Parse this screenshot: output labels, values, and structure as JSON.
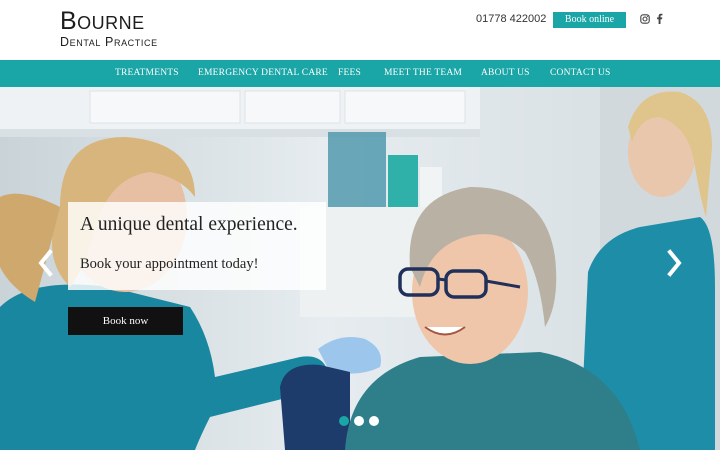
{
  "header": {
    "logo_main": "Bourne",
    "logo_sub": "Dental Practice",
    "phone": "01778 422002",
    "book_online_label": "Book online",
    "social": [
      "instagram-icon",
      "facebook-icon"
    ]
  },
  "nav": {
    "items": [
      {
        "label": "TREATMENTS"
      },
      {
        "label": "EMERGENCY DENTAL CARE"
      },
      {
        "label": "FEES"
      },
      {
        "label": "MEET THE TEAM"
      },
      {
        "label": "ABOUT US"
      },
      {
        "label": "CONTACT US"
      }
    ]
  },
  "hero": {
    "title": "A unique dental experience.",
    "subtitle": "Book your appointment today!",
    "cta_label": "Book now",
    "prev_icon": "chevron-left-icon",
    "next_icon": "chevron-right-icon",
    "slide_count": 3,
    "active_slide": 1
  },
  "colors": {
    "brand_teal": "#1aa6a6",
    "nav_text": "#ffffff",
    "cta_bg": "#111111"
  }
}
